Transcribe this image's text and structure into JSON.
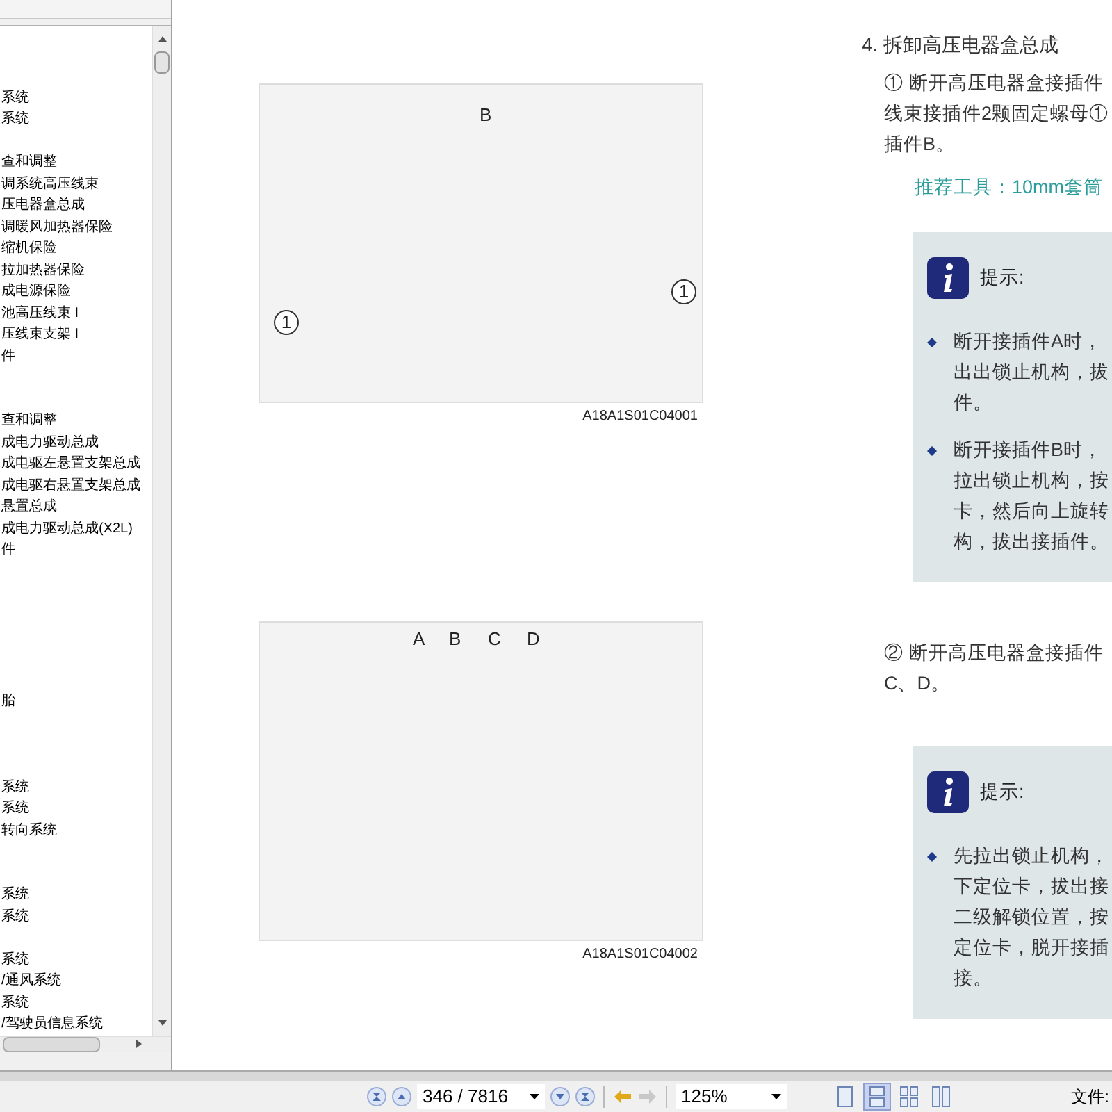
{
  "sidebar": {
    "items": [
      {
        "kind": "item",
        "label": "系统"
      },
      {
        "kind": "item",
        "label": "系统"
      },
      {
        "kind": "spacer"
      },
      {
        "kind": "item",
        "label": "查和调整"
      },
      {
        "kind": "item",
        "label": "调系统高压线束"
      },
      {
        "kind": "item",
        "label": "压电器盒总成"
      },
      {
        "kind": "item",
        "label": "调暖风加热器保险"
      },
      {
        "kind": "item",
        "label": "缩机保险"
      },
      {
        "kind": "item",
        "label": "拉加热器保险"
      },
      {
        "kind": "item",
        "label": "成电源保险"
      },
      {
        "kind": "item",
        "label": "池高压线束 I"
      },
      {
        "kind": "item",
        "label": "压线束支架 I"
      },
      {
        "kind": "item",
        "label": "件"
      },
      {
        "kind": "spacer"
      },
      {
        "kind": "spacer"
      },
      {
        "kind": "item",
        "label": "查和调整"
      },
      {
        "kind": "item",
        "label": "成电力驱动总成"
      },
      {
        "kind": "item",
        "label": "成电驱左悬置支架总成"
      },
      {
        "kind": "item",
        "label": "成电驱右悬置支架总成"
      },
      {
        "kind": "item",
        "label": "悬置总成"
      },
      {
        "kind": "item",
        "label": "成电力驱动总成(X2L)"
      },
      {
        "kind": "item",
        "label": "件"
      },
      {
        "kind": "spacer"
      },
      {
        "kind": "spacer"
      },
      {
        "kind": "spacer"
      },
      {
        "kind": "spacer"
      },
      {
        "kind": "spacer"
      },
      {
        "kind": "spacer"
      },
      {
        "kind": "item",
        "label": "胎"
      },
      {
        "kind": "spacer"
      },
      {
        "kind": "spacer"
      },
      {
        "kind": "spacer"
      },
      {
        "kind": "item",
        "label": "系统"
      },
      {
        "kind": "item",
        "label": "系统"
      },
      {
        "kind": "item",
        "label": "转向系统"
      },
      {
        "kind": "spacer"
      },
      {
        "kind": "spacer"
      },
      {
        "kind": "item",
        "label": "系统"
      },
      {
        "kind": "item",
        "label": "系统"
      },
      {
        "kind": "spacer"
      },
      {
        "kind": "item",
        "label": "系统"
      },
      {
        "kind": "item",
        "label": "/通风系统"
      },
      {
        "kind": "item",
        "label": "系统"
      },
      {
        "kind": "item",
        "label": "/驾驶员信息系统"
      }
    ]
  },
  "document": {
    "figures": [
      {
        "code": "A18A1S01C04001",
        "callouts": [
          "B",
          "1",
          "1"
        ]
      },
      {
        "code": "A18A1S01C04002",
        "callouts": [
          "A",
          "B",
          "C",
          "D"
        ]
      }
    ],
    "heading": "4. 拆卸高压电器盒总成",
    "steps": [
      {
        "lines": [
          "① 断开高压电器盒接插件",
          "线束接插件2颗固定螺母①",
          "插件B。"
        ],
        "tool": "推荐工具：10mm套筒",
        "note": {
          "title": "提示:",
          "bullets": [
            [
              "断开接插件A时，",
              "出出锁止机构，拔",
              "件。"
            ],
            [
              "断开接插件B时，",
              "拉出锁止机构，按",
              "卡，然后向上旋转",
              "构，拔出接插件。"
            ]
          ]
        }
      },
      {
        "lines": [
          "② 断开高压电器盒接插件",
          "C、D。"
        ],
        "note": {
          "title": "提示:",
          "bullets": [
            [
              "先拉出锁止机构，",
              "下定位卡，拔出接",
              "二级解锁位置，按",
              "定位卡，脱开接插",
              "接。"
            ]
          ]
        }
      }
    ]
  },
  "toolbar": {
    "page": "346 / 7816",
    "zoom": "125%",
    "back_enabled": true,
    "forward_enabled": false,
    "views": [
      {
        "selected": false
      },
      {
        "selected": true
      },
      {
        "selected": false
      },
      {
        "selected": false
      }
    ],
    "status": "文件:"
  }
}
